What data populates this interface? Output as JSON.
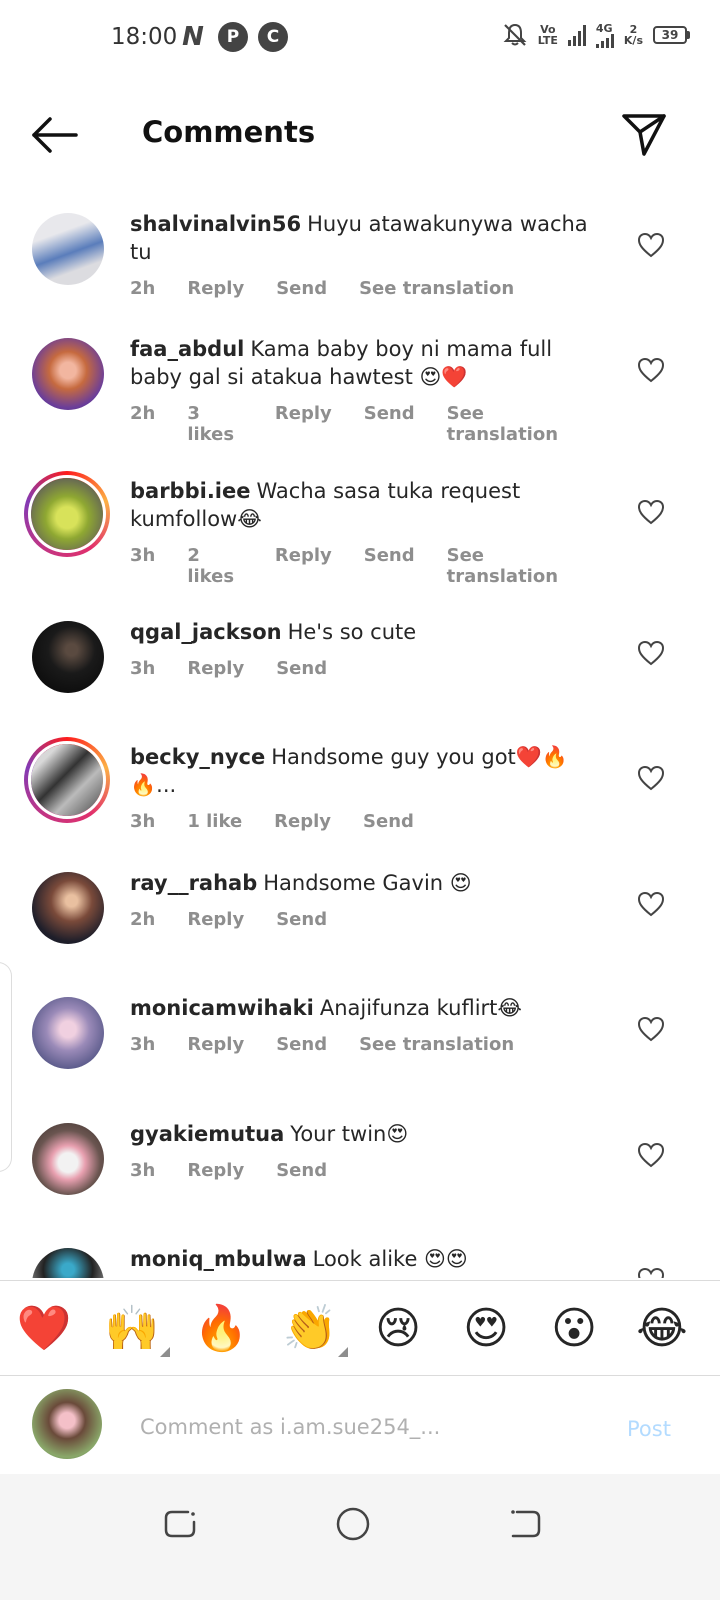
{
  "status_bar": {
    "time": "18:00",
    "left_icons": [
      "netflix-icon",
      "pinterest-icon",
      "c-app-icon"
    ],
    "network_label_top": "4G",
    "lte_label_top": "Vo",
    "lte_label_bottom": "LTE",
    "speed_top": "2",
    "speed_bottom": "K/s",
    "battery": "39"
  },
  "header": {
    "title": "Comments"
  },
  "comments": [
    {
      "username": "shalvinalvin56",
      "text": "Huyu atawakunywa wacha tu",
      "time": "2h",
      "likes": "",
      "reply": "Reply",
      "send": "Send",
      "translation": "See translation",
      "story_ring": false
    },
    {
      "username": "faa_abdul",
      "text": "Kama baby boy ni mama full baby gal si atakua hawtest 😍❤️",
      "time": "2h",
      "likes": "3 likes",
      "reply": "Reply",
      "send": "Send",
      "translation": "See translation",
      "story_ring": false
    },
    {
      "username": "barbbi.iee",
      "text": "Wacha sasa tuka request kumfollow😂",
      "time": "3h",
      "likes": "2 likes",
      "reply": "Reply",
      "send": "Send",
      "translation": "See translation",
      "story_ring": true
    },
    {
      "username": "qgal_jackson",
      "text": "He's so cute",
      "time": "3h",
      "likes": "",
      "reply": "Reply",
      "send": "Send",
      "translation": "",
      "story_ring": false
    },
    {
      "username": "becky_nyce",
      "text": "Handsome guy you got❤️🔥🔥...",
      "time": "3h",
      "likes": "1 like",
      "reply": "Reply",
      "send": "Send",
      "translation": "",
      "story_ring": true
    },
    {
      "username": "ray__rahab",
      "text": "Handsome Gavin 😍",
      "time": "2h",
      "likes": "",
      "reply": "Reply",
      "send": "Send",
      "translation": "",
      "story_ring": false
    },
    {
      "username": "monicamwihaki",
      "text": "Anajifunza kuflirt😂",
      "time": "3h",
      "likes": "",
      "reply": "Reply",
      "send": "Send",
      "translation": "See translation",
      "story_ring": false
    },
    {
      "username": "gyakiemutua",
      "text": "Your twin😍",
      "time": "3h",
      "likes": "",
      "reply": "Reply",
      "send": "Send",
      "translation": "",
      "story_ring": false
    },
    {
      "username": "moniq_mbulwa",
      "text": "Look alike 😍😍",
      "time": "",
      "likes": "",
      "reply": "",
      "send": "",
      "translation": "",
      "story_ring": false
    }
  ],
  "reactions": [
    "❤️",
    "🙌",
    "🔥",
    "👏",
    "😢",
    "😍",
    "😮",
    "😂"
  ],
  "composer": {
    "placeholder": "Comment as i.am.sue254_...",
    "post_label": "Post"
  },
  "colors": {
    "link_disabled": "#b3dbff",
    "meta_gray": "#8e8e8e",
    "heart": "#262626"
  }
}
